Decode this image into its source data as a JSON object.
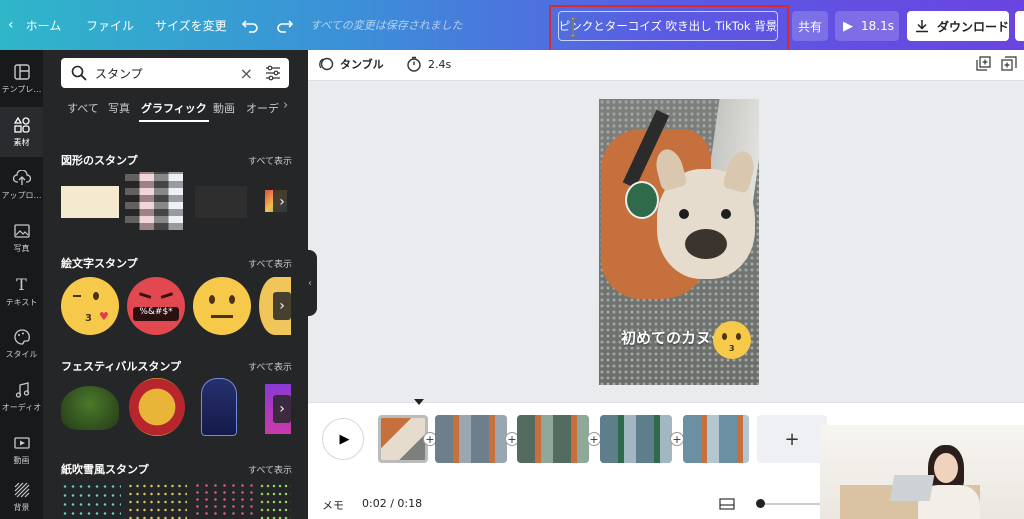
{
  "topbar": {
    "home_label": "ホーム",
    "file_label": "ファイル",
    "resize_label": "サイズを変更",
    "save_status": "すべての変更は保存されました",
    "design_title": "ピンクとターコイズ 吹き出し TikTok 背景",
    "share_label": "共有",
    "duration_label": "18.1s",
    "download_label": "ダウンロード"
  },
  "rail": {
    "items": [
      {
        "label": "テンプレ…",
        "icon": "template-icon"
      },
      {
        "label": "素材",
        "icon": "elements-icon"
      },
      {
        "label": "アップロ…",
        "icon": "upload-icon"
      },
      {
        "label": "写真",
        "icon": "photo-icon"
      },
      {
        "label": "テキスト",
        "icon": "text-icon"
      },
      {
        "label": "スタイル",
        "icon": "palette-icon"
      },
      {
        "label": "オーディオ",
        "icon": "music-icon"
      },
      {
        "label": "動画",
        "icon": "video-icon"
      },
      {
        "label": "背景",
        "icon": "background-icon"
      }
    ]
  },
  "panel": {
    "search_value": "スタンプ",
    "tabs": [
      "すべて",
      "写真",
      "グラフィック",
      "動画",
      "オーデ"
    ],
    "sections": [
      {
        "title": "図形のスタンプ",
        "see_all": "すべて表示"
      },
      {
        "title": "絵文字スタンプ",
        "see_all": "すべて表示"
      },
      {
        "title": "フェスティバルスタンプ",
        "see_all": "すべて表示"
      },
      {
        "title": "紙吹雪風スタンプ",
        "see_all": "すべて表示"
      }
    ],
    "emoji_text": "%&#$*"
  },
  "subbar": {
    "template_label": "タンブル",
    "timer_label": "2.4s"
  },
  "canvas": {
    "caption": "初めてのカヌー"
  },
  "timeline": {
    "memo_label": "メモ",
    "time_label": "0:02 / 0:18"
  },
  "colors": {
    "accent_red": "#d62b2b",
    "panel_bg": "#252627",
    "rail_bg": "#18191b"
  }
}
